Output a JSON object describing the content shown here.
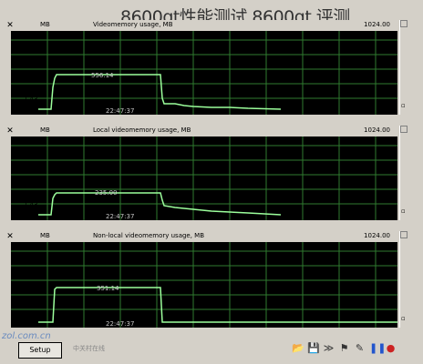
{
  "window": {
    "overlay_title": "8600gt性能测试,8600gt 评测"
  },
  "panels": [
    {
      "header_label": "MB",
      "header_unit": "Videomemory usage, MB",
      "header_title": "",
      "max_value": "1024.00",
      "min_value": "1.43",
      "peak_label": "556.14",
      "time_label": "22:47:37"
    },
    {
      "header_label": "MB",
      "header_unit": "Local videomemory usage, MB",
      "header_title": "",
      "max_value": "1024.00",
      "min_value": "1.43",
      "peak_label": "235.00",
      "time_label": "22:47:37"
    },
    {
      "header_label": "MB",
      "header_unit": "Non-local videomemory usage, MB",
      "header_title": "",
      "max_value": "1024.00",
      "min_value": "0.00",
      "peak_label": "351.14",
      "time_label": "22:47:37"
    }
  ],
  "bottom": {
    "setup_label": "Setup",
    "watermark_site": "zol.com.cn",
    "watermark_cn": "中关村在线"
  },
  "toolbar_icons": [
    "folder-icon",
    "save-icon",
    "chevrons-icon",
    "flag-icon",
    "brush-icon",
    "pause-icon",
    "record-icon"
  ]
}
